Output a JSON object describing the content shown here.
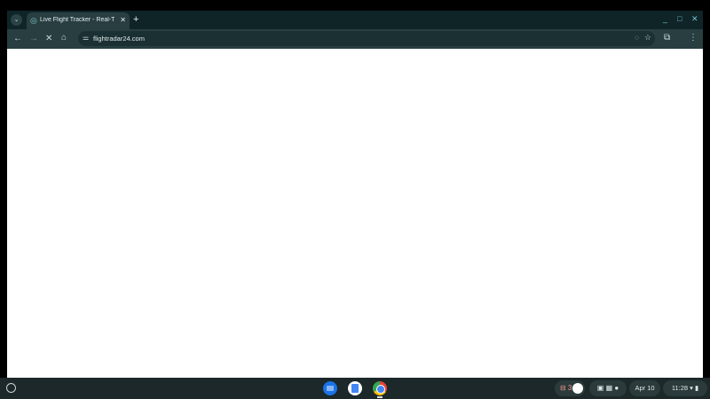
{
  "tab": {
    "title": "Live Flight Tracker - Real-Time Flight Tracker",
    "close": "✕"
  },
  "new_tab": "+",
  "window_controls": {
    "minimize": "_",
    "maximize": "□",
    "close": "✕"
  },
  "toolbar": {
    "back": "←",
    "forward": "→",
    "stop": "✕",
    "home": "⌂",
    "url": "flightradar24.com",
    "extensions": "⧉",
    "menu": "⋮"
  },
  "shelf": {
    "date": "Apr 10",
    "time": "11:28",
    "tray_indicator": "⊟ 3",
    "status_icons": "▣ ▦ ●"
  }
}
